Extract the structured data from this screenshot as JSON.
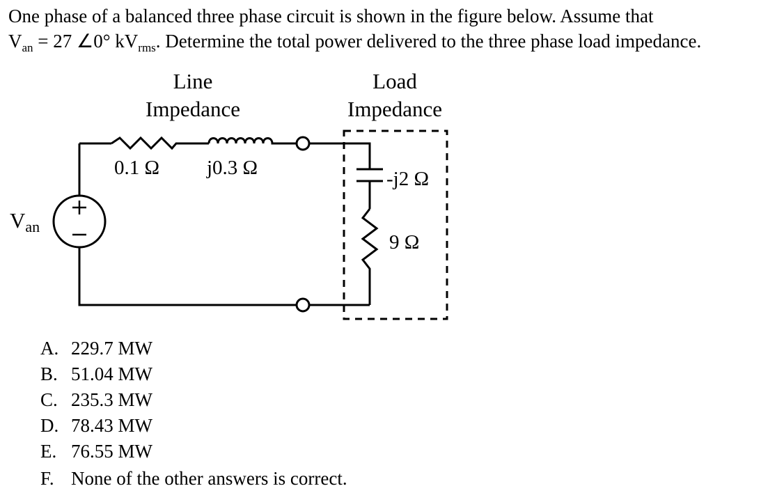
{
  "question": {
    "line1": "One phase of a balanced three phase circuit is shown in the figure below.  Assume that",
    "line2_prefix": "V",
    "line2_sub": "an",
    "line2_mid": " = 27 ∠0° kV",
    "line2_sub2": "rms",
    "line2_suffix": ".  Determine the total power delivered to the three phase load impedance."
  },
  "figure": {
    "line_impedance_label": [
      "Line",
      "Impedance"
    ],
    "load_impedance_label": [
      "Load",
      "Impedance"
    ],
    "source_label": "V",
    "source_label_sub": "an",
    "resistor_line": "0.1 Ω",
    "inductor_line": "j0.3 Ω",
    "capacitor_load": "-j2 Ω",
    "resistor_load": "9 Ω",
    "plus_sign": "+",
    "minus_sign": "−"
  },
  "choices": [
    {
      "letter": "A.",
      "text": "229.7 MW"
    },
    {
      "letter": "B.",
      "text": "51.04 MW"
    },
    {
      "letter": "C.",
      "text": "235.3 MW"
    },
    {
      "letter": "D.",
      "text": "78.43 MW"
    },
    {
      "letter": "E.",
      "text": "76.55 MW"
    },
    {
      "letter": "F.",
      "text": "None of the other answers is correct."
    }
  ]
}
